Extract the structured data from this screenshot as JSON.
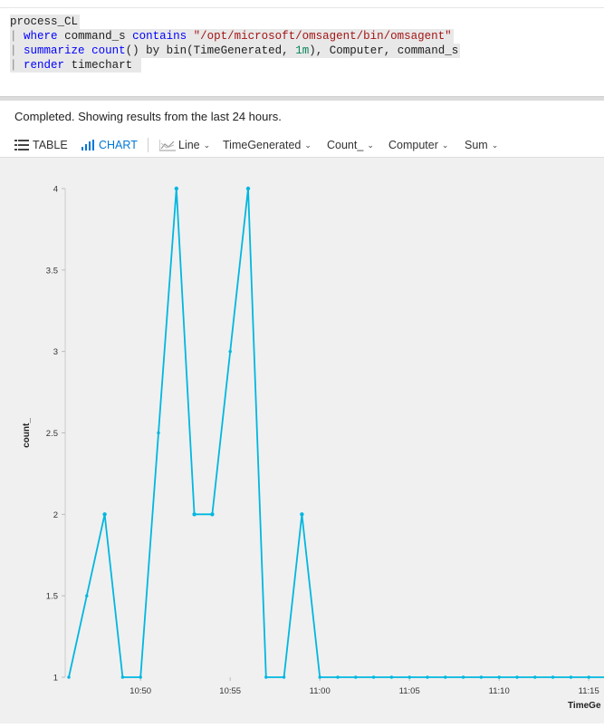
{
  "query": {
    "line1": "process_CL",
    "line2_where": "where",
    "line2_field": "command_s",
    "line2_op": "contains",
    "line2_value": "\"/opt/microsoft/omsagent/bin/omsagent\"",
    "line3_summarize": "summarize",
    "line3_count": "count",
    "line3_paren": "()",
    "line3_by": "by",
    "line3_bin": "bin",
    "line3_rest_a": "(TimeGenerated,",
    "line3_num": "1m",
    "line3_rest_b": "), Computer, command_s",
    "line4_render": "render",
    "line4_timechart": "timechart",
    "pipe": "|"
  },
  "status": "Completed. Showing results from the last 24 hours.",
  "toolbar": {
    "table_label": "TABLE",
    "chart_label": "CHART",
    "line_label": "Line",
    "x_field": "TimeGenerated",
    "y_field": "Count_",
    "split_field": "Computer",
    "aggregation": "Sum"
  },
  "colors": {
    "accent": "#0078d4",
    "series": "#00b7e0"
  },
  "chart_data": {
    "type": "line",
    "xlabel": "TimeGe",
    "ylabel": "count_",
    "ylim": [
      1,
      4
    ],
    "yticks": [
      "1",
      "1.5",
      "2",
      "2.5",
      "3",
      "3.5",
      "4"
    ],
    "xticks": [
      "10:50",
      "10:55",
      "11:00",
      "11:05",
      "11:10",
      "11:15"
    ],
    "x": [
      "10:46",
      "10:47",
      "10:48",
      "10:49",
      "10:50",
      "10:51",
      "10:52",
      "10:53",
      "10:54",
      "10:55",
      "10:56",
      "10:57",
      "10:58",
      "10:59",
      "11:00",
      "11:01",
      "11:02",
      "11:03",
      "11:04",
      "11:05",
      "11:06",
      "11:07",
      "11:08",
      "11:09",
      "11:10",
      "11:11",
      "11:12",
      "11:13",
      "11:14",
      "11:15",
      "11:16"
    ],
    "series": [
      {
        "values": [
          1,
          1.5,
          2,
          1,
          1,
          2.5,
          4,
          2,
          2,
          3,
          4,
          1,
          1,
          2,
          1,
          1,
          1,
          1,
          1,
          1,
          1,
          1,
          1,
          1,
          1,
          1,
          1,
          1,
          1,
          1,
          1
        ]
      }
    ]
  }
}
